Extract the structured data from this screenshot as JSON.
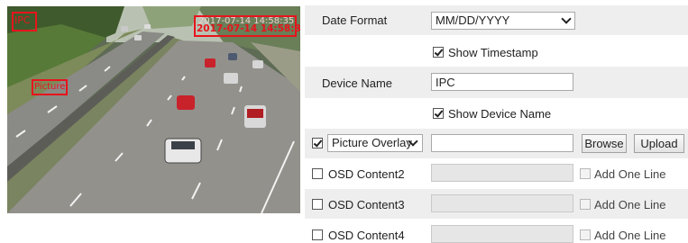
{
  "preview": {
    "overlay_ipc": "IPC",
    "overlay_picture": "Picture",
    "timestamp_back": "2017-07-14 14:58:35",
    "timestamp_front": "2017-07-14 14:58:35"
  },
  "settings": {
    "date_format": {
      "label": "Date Format",
      "value": "MM/DD/YYYY"
    },
    "show_timestamp": {
      "label": "Show Timestamp",
      "checked": true
    },
    "device_name": {
      "label": "Device Name",
      "value": "IPC"
    },
    "show_device_name": {
      "label": "Show Device Name",
      "checked": true
    },
    "picture_overlay": {
      "select_value": "Picture Overlay",
      "checked": true,
      "input_value": "",
      "browse_label": "Browse",
      "upload_label": "Upload"
    },
    "osd_rows": [
      {
        "label": "OSD Content2",
        "checked": false,
        "add_line_label": "Add One Line"
      },
      {
        "label": "OSD Content3",
        "checked": false,
        "add_line_label": "Add One Line"
      },
      {
        "label": "OSD Content4",
        "checked": false,
        "add_line_label": "Add One Line"
      }
    ]
  },
  "colors": {
    "overlay_red": "#e8141c",
    "row_shade": "#eeeeee"
  }
}
